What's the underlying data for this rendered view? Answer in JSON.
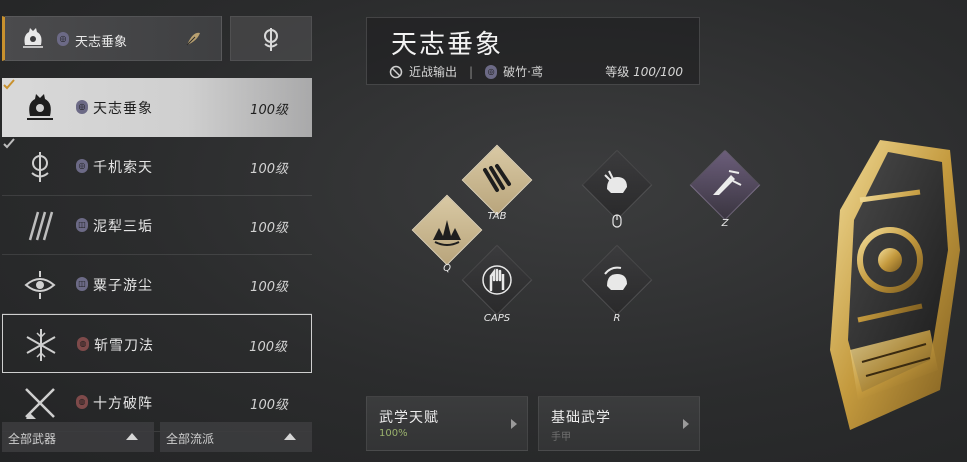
{
  "equipped": {
    "primary_name": "天志垂象",
    "primary_icon": "palm-fist-icon",
    "secondary_icon": "twin-blade-icon"
  },
  "weapon_list": [
    {
      "name": "天志垂象",
      "level": "100级",
      "badge": "ring",
      "icon": "palm-fist-icon"
    },
    {
      "name": "千机索天",
      "level": "100级",
      "badge": "ring",
      "icon": "twin-blade-icon"
    },
    {
      "name": "泥犁三垢",
      "level": "100级",
      "badge": "mo",
      "icon": "triple-claw-icon"
    },
    {
      "name": "粟子游尘",
      "level": "100级",
      "badge": "mo",
      "icon": "eye-fan-icon"
    },
    {
      "name": "斩雪刀法",
      "level": "100级",
      "badge": "blade",
      "icon": "snowflake-sword-icon"
    },
    {
      "name": "十方破阵",
      "level": "100级",
      "badge": "blade",
      "icon": "crossed-spears-icon"
    }
  ],
  "filters": {
    "weapon": "全部武器",
    "school": "全部流派"
  },
  "header": {
    "title": "天志垂象",
    "role": "近战输出",
    "path": "破竹·鸢",
    "level_label": "等级",
    "level_value": "100/100"
  },
  "skills": [
    {
      "key": "TAB",
      "icon": "claw-strike-icon"
    },
    {
      "key": "Q",
      "icon": "burst-palm-icon"
    },
    {
      "key": "CAPS",
      "icon": "raised-fist-icon"
    },
    {
      "key": "",
      "icon": "grab-fist-icon"
    },
    {
      "key": "R",
      "icon": "spin-fist-icon"
    },
    {
      "key": "Z",
      "icon": "dash-strike-icon"
    }
  ],
  "buttons": {
    "talent_title": "武学天赋",
    "talent_progress": "100%",
    "basic_title": "基础武学",
    "basic_sub": "手甲"
  },
  "colors": {
    "accent_gold": "#c8912e",
    "skill_gold": "#d9c9a4",
    "progress_green": "#9ab26d"
  }
}
